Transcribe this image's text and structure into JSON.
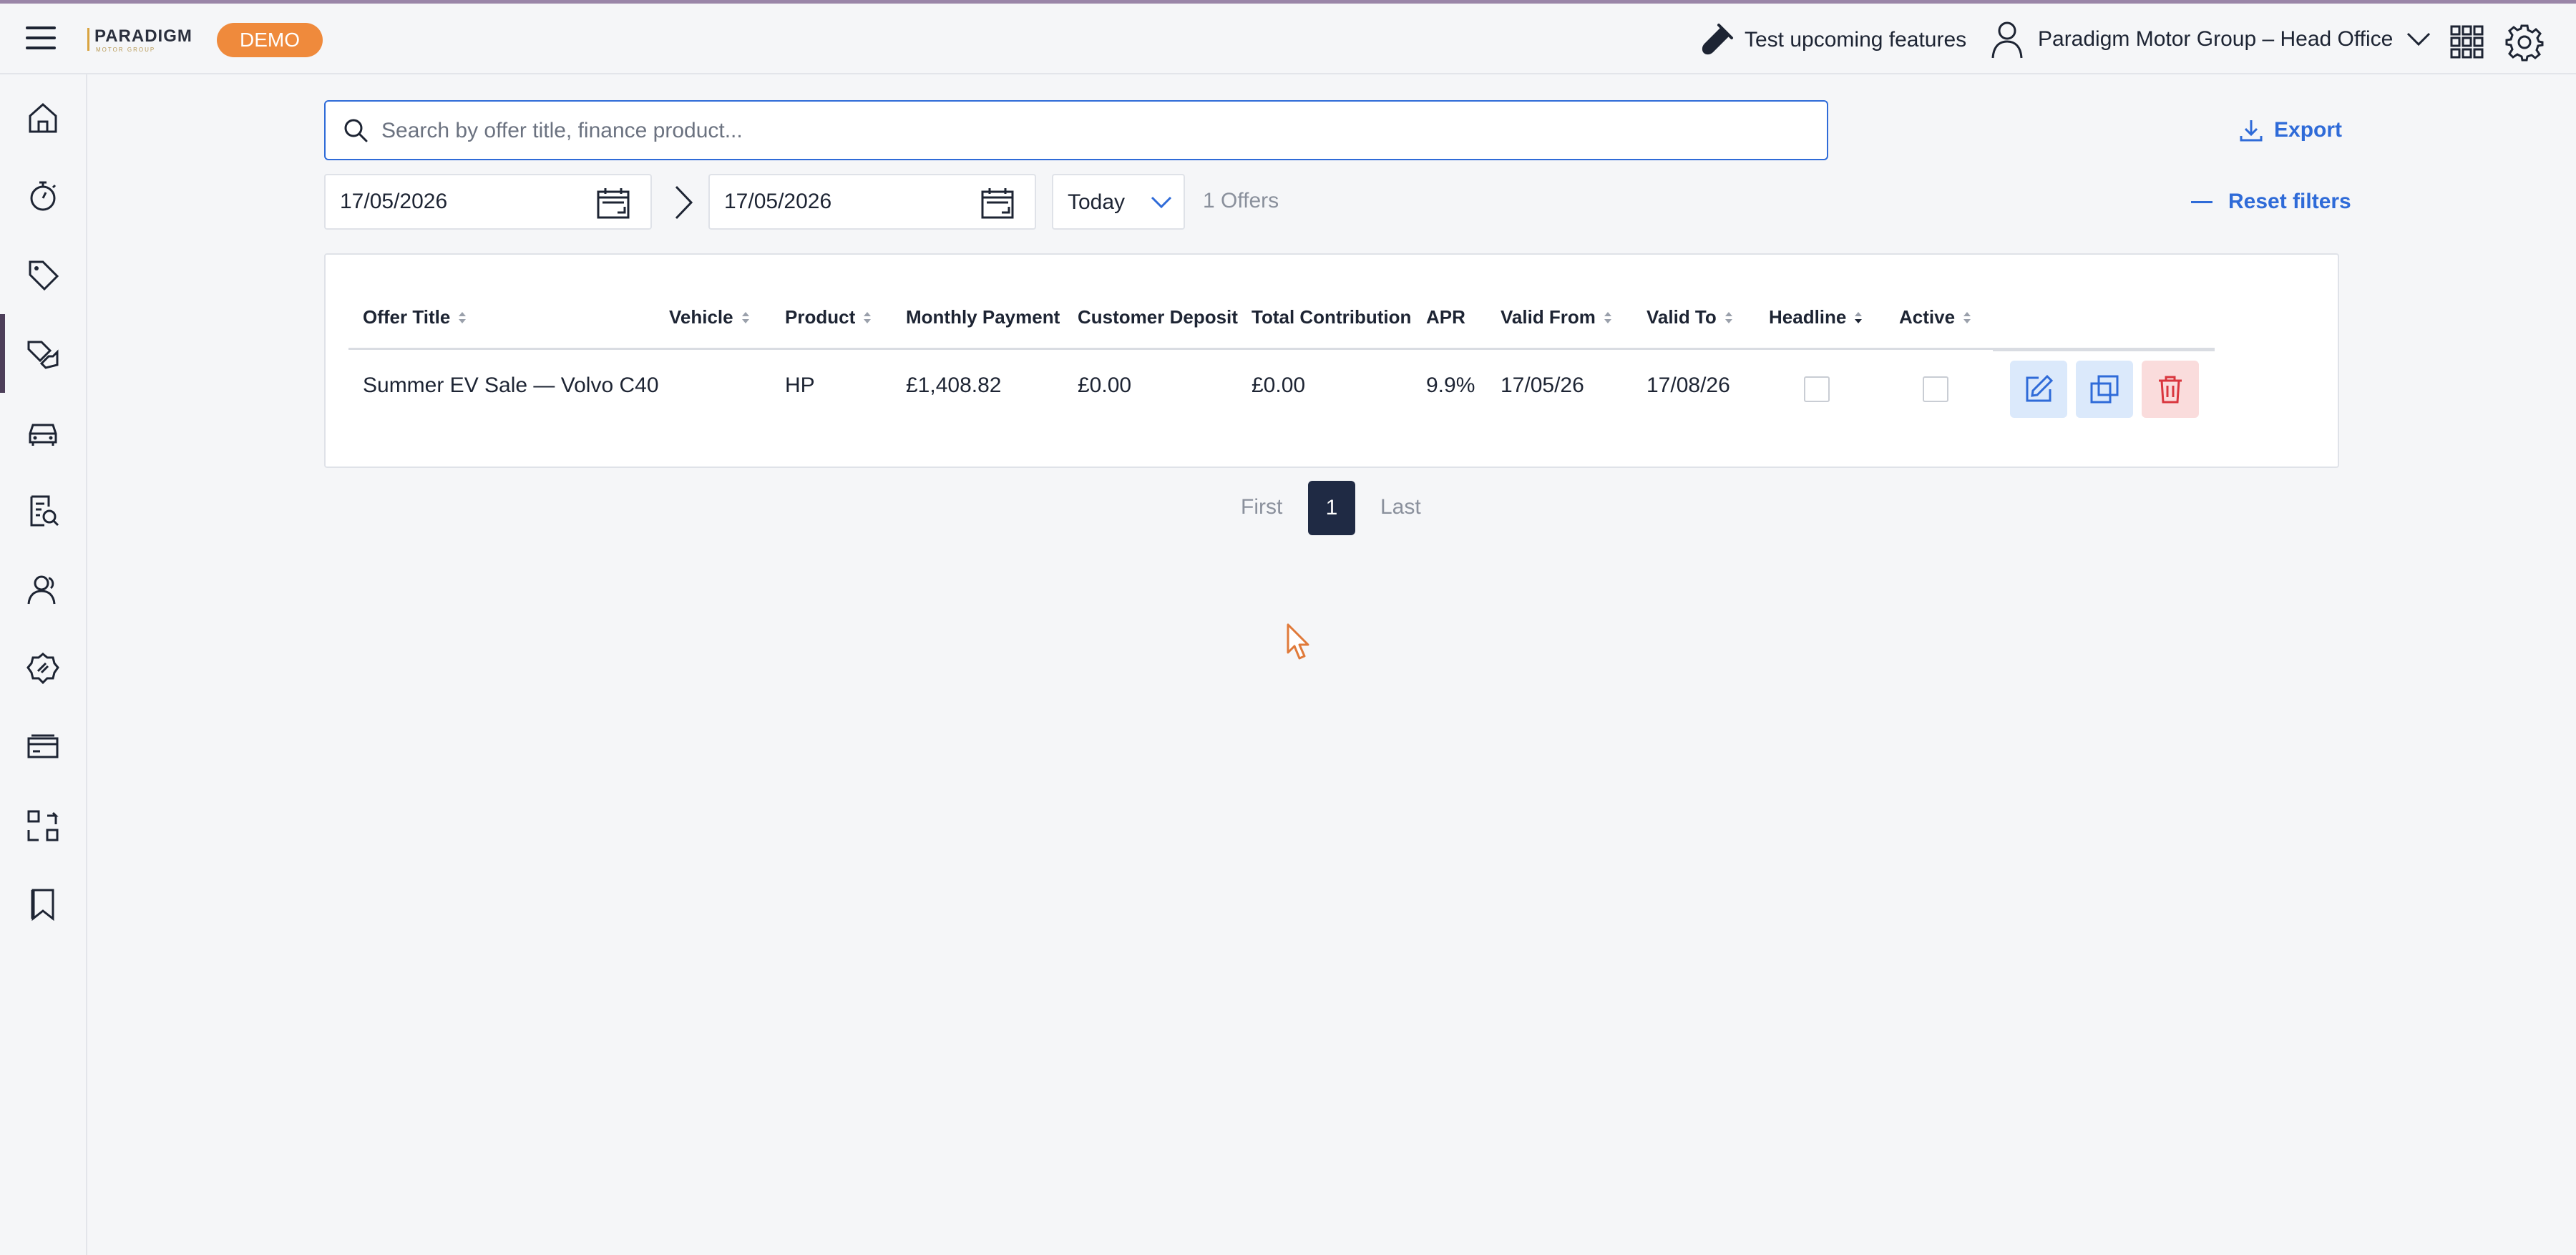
{
  "header": {
    "logo_text": "PARADIGM",
    "logo_subtext": "MOTOR GROUP",
    "badge": "DEMO",
    "test_features": "Test upcoming features",
    "organisation": "Paradigm Motor Group – Head Office"
  },
  "sidebar": {
    "items": [
      "home-icon",
      "stopwatch-icon",
      "tag-icon",
      "finance-offers-icon",
      "car-icon",
      "report-search-icon",
      "users-icon",
      "settings-badge-icon",
      "card-icon",
      "transfer-icon",
      "bookmark-icon"
    ],
    "active_index": 3,
    "accent": "#4d3f5a"
  },
  "search": {
    "placeholder": "Search by offer title, finance product...",
    "value": ""
  },
  "toolbar": {
    "export_label": "Export",
    "reset_label": "Reset filters"
  },
  "filters": {
    "date_from": "17/05/2026",
    "date_to": "17/05/2026",
    "period": "Today",
    "count_label": "1 Offers"
  },
  "table": {
    "columns": [
      "Offer Title",
      "Vehicle",
      "Product",
      "Monthly Payment",
      "Customer Deposit",
      "Total Contribution",
      "APR",
      "Valid From",
      "Valid To",
      "Headline",
      "Active"
    ],
    "rows": [
      {
        "offer_title": "Summer EV Sale — Volvo C40",
        "vehicle": "",
        "product": "HP",
        "monthly_payment": "£1,408.82",
        "customer_deposit": "£0.00",
        "total_contribution": "£0.00",
        "apr": "9.9%",
        "valid_from": "17/05/26",
        "valid_to": "17/08/26",
        "headline": false,
        "active": false
      }
    ]
  },
  "pagination": {
    "first": "First",
    "current": "1",
    "last": "Last"
  },
  "colors": {
    "primary": "#2f6bd8",
    "badge": "#ef8a3c",
    "pager_active": "#1f2a44",
    "delete": "#d9363e"
  }
}
